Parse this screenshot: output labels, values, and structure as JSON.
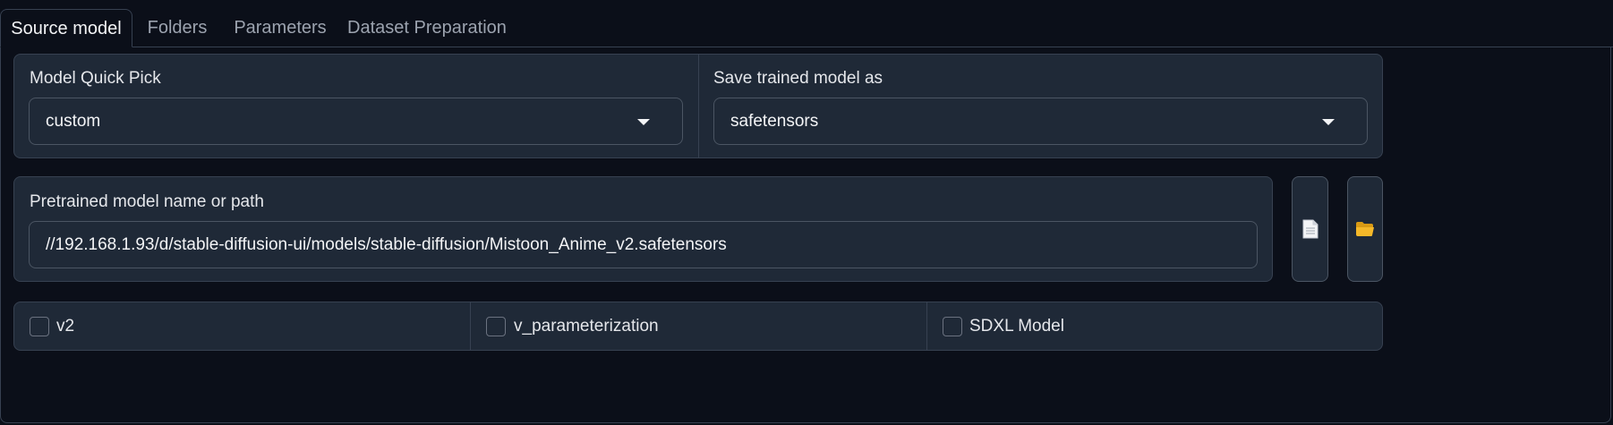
{
  "tabs": [
    {
      "label": "Source model",
      "active": true
    },
    {
      "label": "Folders",
      "active": false
    },
    {
      "label": "Parameters",
      "active": false
    },
    {
      "label": "Dataset Preparation",
      "active": false
    }
  ],
  "model_quick_pick": {
    "label": "Model Quick Pick",
    "value": "custom"
  },
  "save_trained_model_as": {
    "label": "Save trained model as",
    "value": "safetensors"
  },
  "pretrained_model": {
    "label": "Pretrained model name or path",
    "value": "//192.168.1.93/d/stable-diffusion-ui/models/stable-diffusion/Mistoon_Anime_v2.safetensors",
    "file_button_icon": "document-icon",
    "folder_button_icon": "folder-icon"
  },
  "checkboxes": [
    {
      "label": "v2",
      "checked": false
    },
    {
      "label": "v_parameterization",
      "checked": false
    },
    {
      "label": "SDXL Model",
      "checked": false
    }
  ],
  "colors": {
    "background": "#0b0f19",
    "block": "#1f2937",
    "border": "#374151",
    "folder": "#f5b829"
  }
}
